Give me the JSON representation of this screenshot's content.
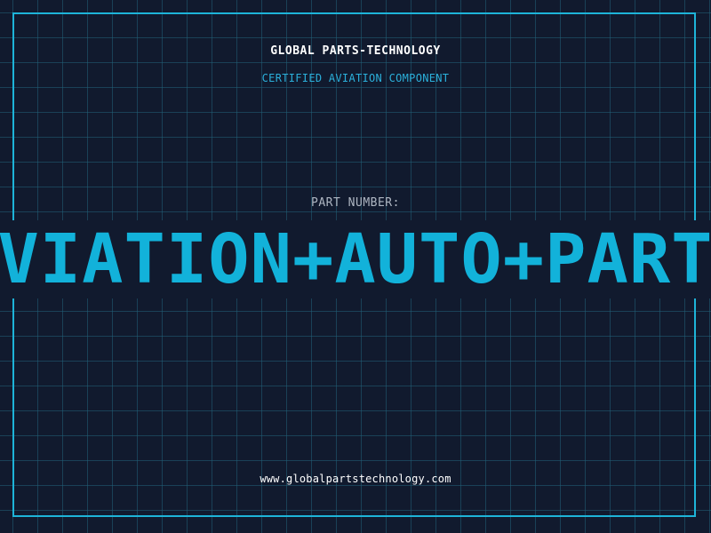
{
  "header": {
    "company": "GLOBAL PARTS-TECHNOLOGY",
    "subtitle": "CERTIFIED AVIATION COMPONENT"
  },
  "part": {
    "label": "PART NUMBER:",
    "number": "AVIATION+AUTO+PARTS"
  },
  "footer": {
    "website": "www.globalpartstechnology.com"
  },
  "colors": {
    "background": "#111a2e",
    "grid": "#206078",
    "accent": "#1eb4d8",
    "heading": "#ffffff",
    "muted": "#aeb6c2"
  }
}
